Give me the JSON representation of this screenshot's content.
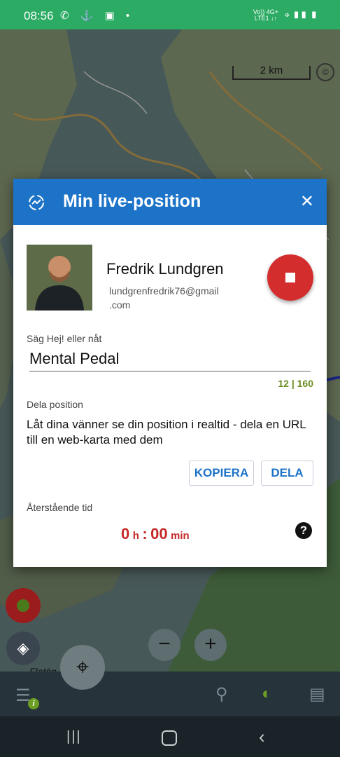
{
  "status_bar": {
    "time": "08:56",
    "left_icons": "✆ ⚓ ▣ •",
    "network_top": "Vo)) 4G+",
    "network_bottom": "LTE1 ↓↑",
    "right_icons": "⌖ ▮▮ ▮"
  },
  "map": {
    "scale_label": "2 km",
    "copyright_symbol": "©",
    "place_label": "Flatön"
  },
  "dialog": {
    "title": "Min live-position",
    "close_symbol": "✕",
    "user": {
      "name": "Fredrik Lundgren",
      "email_line1": "lundgrenfredrik76@gmail",
      "email_line2": ".com"
    },
    "message": {
      "label": "Säg Hej! eller nåt",
      "value": "Mental Pedal",
      "counter": "12 | 160"
    },
    "share": {
      "label": "Dela position",
      "description": "Låt dina vänner se din position i realtid - dela en URL till en web-karta med dem",
      "copy_button": "KOPIERA",
      "share_button": "DELA"
    },
    "remaining": {
      "label": "Återstående tid",
      "hours": "0",
      "hours_unit": "h",
      "separator": ":",
      "minutes": "00",
      "minutes_unit": "min"
    },
    "help_symbol": "?"
  },
  "controls": {
    "zoom_out": "−",
    "zoom_in": "+",
    "locate_symbol": "⌖",
    "layers_symbol": "◈"
  },
  "app_bar": {
    "menu_symbol": "☰",
    "info_symbol": "i",
    "search_symbol": "⚲",
    "satellite_symbol": "◐",
    "phone_symbol": "▤"
  },
  "nav_bar": {
    "recent_symbol": "|||",
    "back_symbol": "‹"
  },
  "colors": {
    "status_bar": "#2bab63",
    "dialog_header": "#1c73c8",
    "stop_button": "#d32d2d",
    "timer_text": "#c62828",
    "counter_text": "#6b8e23"
  }
}
